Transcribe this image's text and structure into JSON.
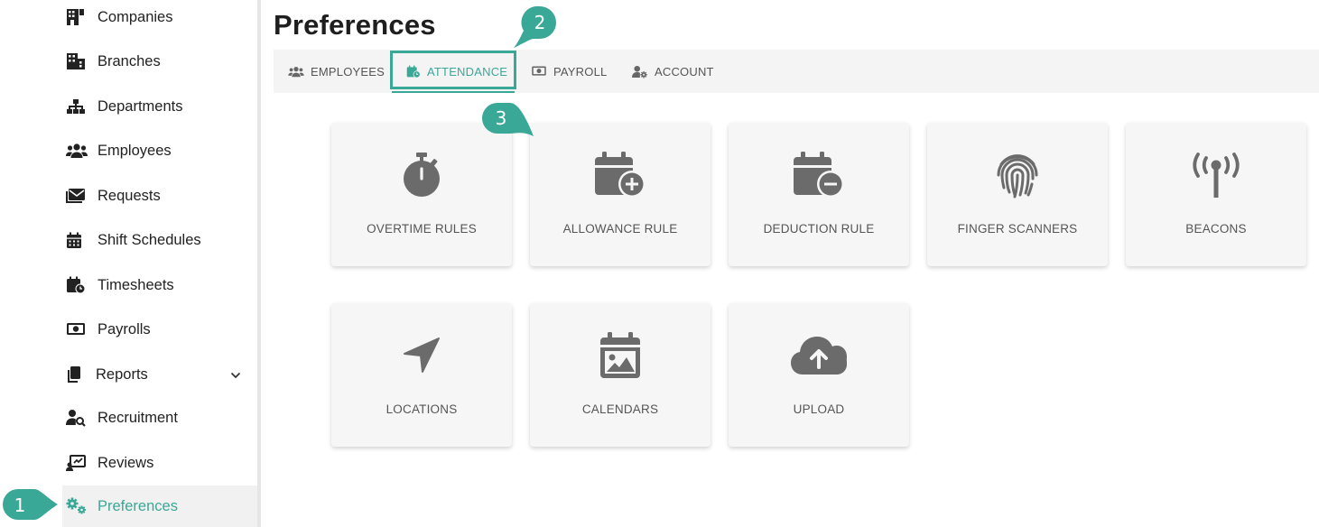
{
  "sidebar": {
    "items": [
      {
        "label": "Companies",
        "icon": "building-icon"
      },
      {
        "label": "Branches",
        "icon": "branches-icon"
      },
      {
        "label": "Departments",
        "icon": "sitemap-icon"
      },
      {
        "label": "Employees",
        "icon": "users-icon"
      },
      {
        "label": "Requests",
        "icon": "envelope-icon"
      },
      {
        "label": "Shift Schedules",
        "icon": "calendar-icon"
      },
      {
        "label": "Timesheets",
        "icon": "calendar-clock-icon"
      },
      {
        "label": "Payrolls",
        "icon": "money-icon"
      },
      {
        "label": "Reports",
        "icon": "copy-icon"
      },
      {
        "label": "Recruitment",
        "icon": "user-search-icon"
      },
      {
        "label": "Reviews",
        "icon": "review-icon"
      },
      {
        "label": "Preferences",
        "icon": "gears-icon"
      }
    ],
    "active_item": "Preferences"
  },
  "page": {
    "title": "Preferences"
  },
  "tabs": [
    {
      "label": "EMPLOYEES",
      "icon": "users-icon"
    },
    {
      "label": "ATTENDANCE",
      "icon": "calendar-clock-icon"
    },
    {
      "label": "PAYROLL",
      "icon": "money-icon"
    },
    {
      "label": "ACCOUNT",
      "icon": "user-gear-icon"
    }
  ],
  "active_tab": "ATTENDANCE",
  "cards": [
    {
      "label": "OVERTIME RULES",
      "icon": "stopwatch-icon"
    },
    {
      "label": "ALLOWANCE RULE",
      "icon": "calendar-plus-icon"
    },
    {
      "label": "DEDUCTION RULE",
      "icon": "calendar-minus-icon"
    },
    {
      "label": "FINGER SCANNERS",
      "icon": "fingerprint-icon"
    },
    {
      "label": "BEACONS",
      "icon": "broadcast-icon"
    },
    {
      "label": "LOCATIONS",
      "icon": "location-arrow-icon"
    },
    {
      "label": "CALENDARS",
      "icon": "calendar-image-icon"
    },
    {
      "label": "UPLOAD",
      "icon": "cloud-upload-icon"
    }
  ],
  "markers": [
    "1",
    "2",
    "3"
  ],
  "colors": {
    "accent": "#3aa897",
    "icon": "#6b6b6b",
    "card_bg": "#f6f6f6",
    "tabbar_bg": "#f4f4f4"
  }
}
